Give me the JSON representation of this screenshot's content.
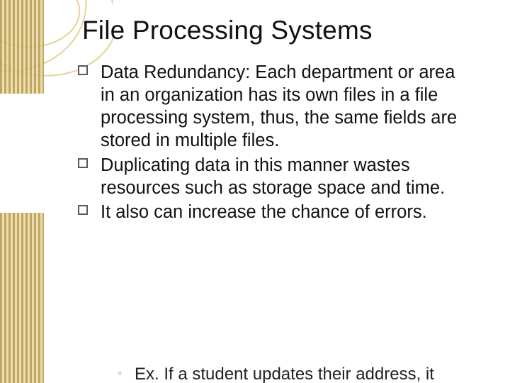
{
  "title": "File Processing Systems",
  "bullets": {
    "b1": "Data Redundancy: Each department or area in an organization has its own files in a file processing system, thus, the same fields are stored in multiple files.",
    "b2": "Duplicating data in this manner wastes resources such as storage space and time.",
    "b3": "It also can increase the chance of errors."
  },
  "subbullet": "Ex. If a student updates their address, it"
}
